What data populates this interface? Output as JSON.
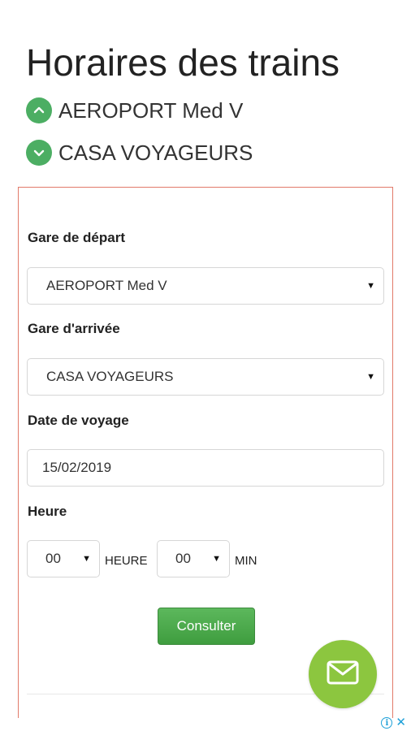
{
  "page": {
    "title": "Horaires des trains"
  },
  "stations": {
    "from": {
      "name": "AEROPORT Med V",
      "icon": "chevron-up-icon"
    },
    "to": {
      "name": "CASA VOYAGEURS",
      "icon": "chevron-down-icon"
    }
  },
  "form": {
    "departure_label": "Gare de départ",
    "departure_value": "AEROPORT Med V",
    "arrival_label": "Gare d'arrivée",
    "arrival_value": "CASA VOYAGEURS",
    "date_label": "Date de voyage",
    "date_value": "15/02/2019",
    "time_label": "Heure",
    "hour_value": "00",
    "hour_unit": "HEURE",
    "minute_value": "00",
    "minute_unit": "MIN",
    "submit_label": "Consulter"
  },
  "fab": {
    "icon": "mail-icon"
  },
  "ad": {
    "info_glyph": "i",
    "close_glyph": "✕"
  },
  "colors": {
    "accent_green": "#4cae63",
    "button_green": "#5cb85c",
    "fab_green": "#8cc63f",
    "form_border": "#e27a6a",
    "ad_blue": "#1ea0d8"
  }
}
